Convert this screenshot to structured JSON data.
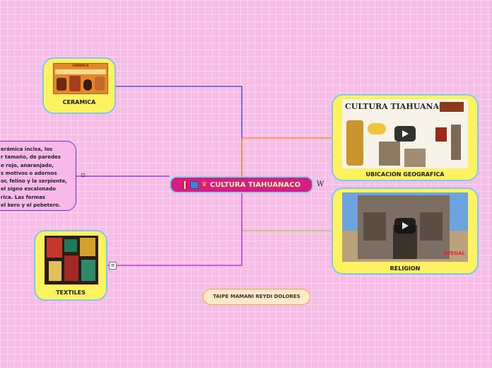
{
  "central": {
    "title": "CULTURA TIAHUANACO"
  },
  "nodes": {
    "ceramica": {
      "label": "CERAMICA",
      "thumb_title": "CERÁMICA"
    },
    "textiles": {
      "label": "TEXTILES"
    },
    "ubicacion": {
      "label": "UBICACION GEOGRAFICA",
      "thumb_title": "CULTURA TIAHUANACO"
    },
    "religion": {
      "label": "RELIGION",
      "watermark": "AVEGAL"
    }
  },
  "text_node": {
    "lines": [
      "erámica incisa, los",
      "r tamaño, de paredes",
      "e rojo, anaranjado,",
      "s motivos o adornos",
      "or, felino y la serpiente,",
      "el signo escalonado",
      "rica. Las formas",
      "el kero y el pebetero."
    ]
  },
  "author": {
    "label": "TAIPE MAMANI REYDI DOLORES"
  },
  "icons": {
    "wiki": "W",
    "list": "≡",
    "note": "⊡"
  },
  "colors": {
    "background": "#f6bde6",
    "node_fill": "#fdf25f",
    "node_border": "#7ec8f0",
    "central_fill": "#d61c86",
    "link_ceramica": "#2e3ed1",
    "link_ubicacion": "#f28a1e",
    "link_religion": "#8fdc3a",
    "link_textiles": "#c21ad1",
    "link_text": "#7b29c9"
  }
}
